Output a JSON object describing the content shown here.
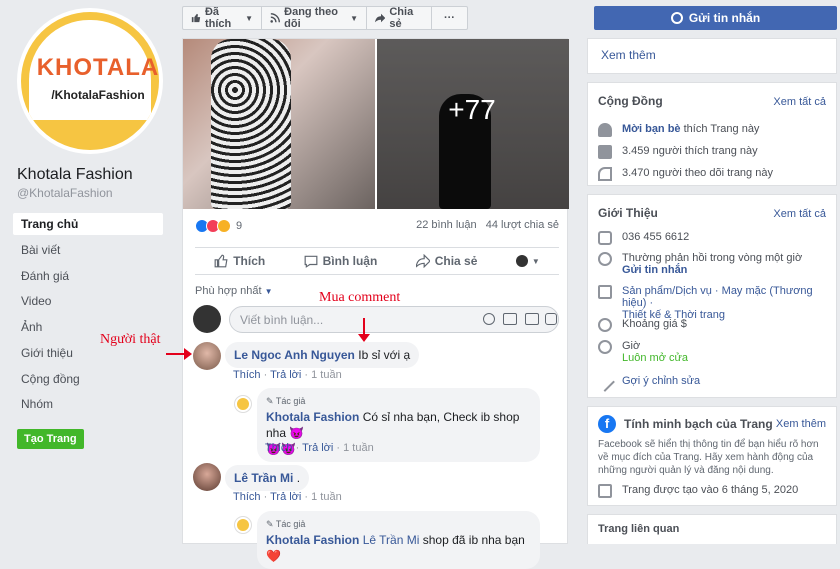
{
  "sidebar": {
    "logo_text": "KHOTALA",
    "logo_handle": "/KhotalaFashion",
    "page_name": "Khotala Fashion",
    "page_handle": "@KhotalaFashion",
    "items": [
      "Trang chủ",
      "Bài viết",
      "Đánh giá",
      "Video",
      "Ảnh",
      "Giới thiệu",
      "Cộng đồng",
      "Nhóm"
    ],
    "create_page": "Tạo Trang"
  },
  "toolbar": {
    "liked": "Đã thích",
    "following": "Đang theo dõi",
    "share": "Chia sẻ",
    "more": "···"
  },
  "post": {
    "more_photos": "+77",
    "reaction_count": "9",
    "comments": "22 bình luận",
    "shares": "44 lượt chia sẻ",
    "like": "Thích",
    "comment": "Bình luận",
    "share": "Chia sẻ",
    "sort": "Phù hợp nhất",
    "comment_placeholder": "Viết bình luận..."
  },
  "comments": [
    {
      "name": "Le Ngoc Anh Nguyen",
      "text": "Ib sỉ với ạ",
      "like": "Thích",
      "reply": "Trả lời",
      "time": "1 tuần"
    },
    {
      "author_tag": "Tác giả",
      "name": "Khotala Fashion",
      "text": "Có sỉ nha bạn, Check ib shop nha 😈",
      "text2": "😈😈",
      "like": "Thích",
      "reply": "Trả lời",
      "time": "1 tuần"
    },
    {
      "name": "Lê Trần Mi",
      "text": ".",
      "like": "Thích",
      "reply": "Trả lời",
      "time": "1 tuần"
    },
    {
      "author_tag": "Tác giả",
      "name": "Khotala Fashion",
      "mention": "Lê Trần Mi",
      "text": "shop đã ib nha bạn ❤️"
    }
  ],
  "annotations": {
    "real_person": "Người thật",
    "buy_comment": "Mua comment"
  },
  "right": {
    "send_message": "Gửi tin nhắn",
    "see_more": "Xem thêm",
    "community": {
      "title": "Cộng Đồng",
      "see_all": "Xem tất cả",
      "invite_link": "Mời bạn bè",
      "invite_text": "thích Trang này",
      "likes": "3.459 người thích trang này",
      "follows": "3.470 người theo dõi trang này"
    },
    "about": {
      "title": "Giới Thiệu",
      "see_all": "Xem tất cả",
      "phone": "036 455 6612",
      "response": "Thường phản hồi trong vòng một giờ",
      "send_message": "Gửi tin nhắn",
      "category": "Sản phẩm/Dịch vụ · May mặc (Thương hiệu) ·",
      "category2": "Thiết kế & Thời trang",
      "price": "Khoảng giá $",
      "hours": "Giờ",
      "open": "Luôn mở cửa",
      "edit": "Gợi ý chỉnh sửa"
    },
    "transparency": {
      "title": "Tính minh bạch của Trang",
      "see_more": "Xem thêm",
      "desc": "Facebook sẽ hiển thị thông tin để bạn hiểu rõ hơn về mục đích của Trang. Hãy xem hành động của những người quản lý và đăng nội dung.",
      "created": "Trang được tạo vào 6 tháng 5, 2020"
    },
    "related": "Trang liên quan"
  }
}
